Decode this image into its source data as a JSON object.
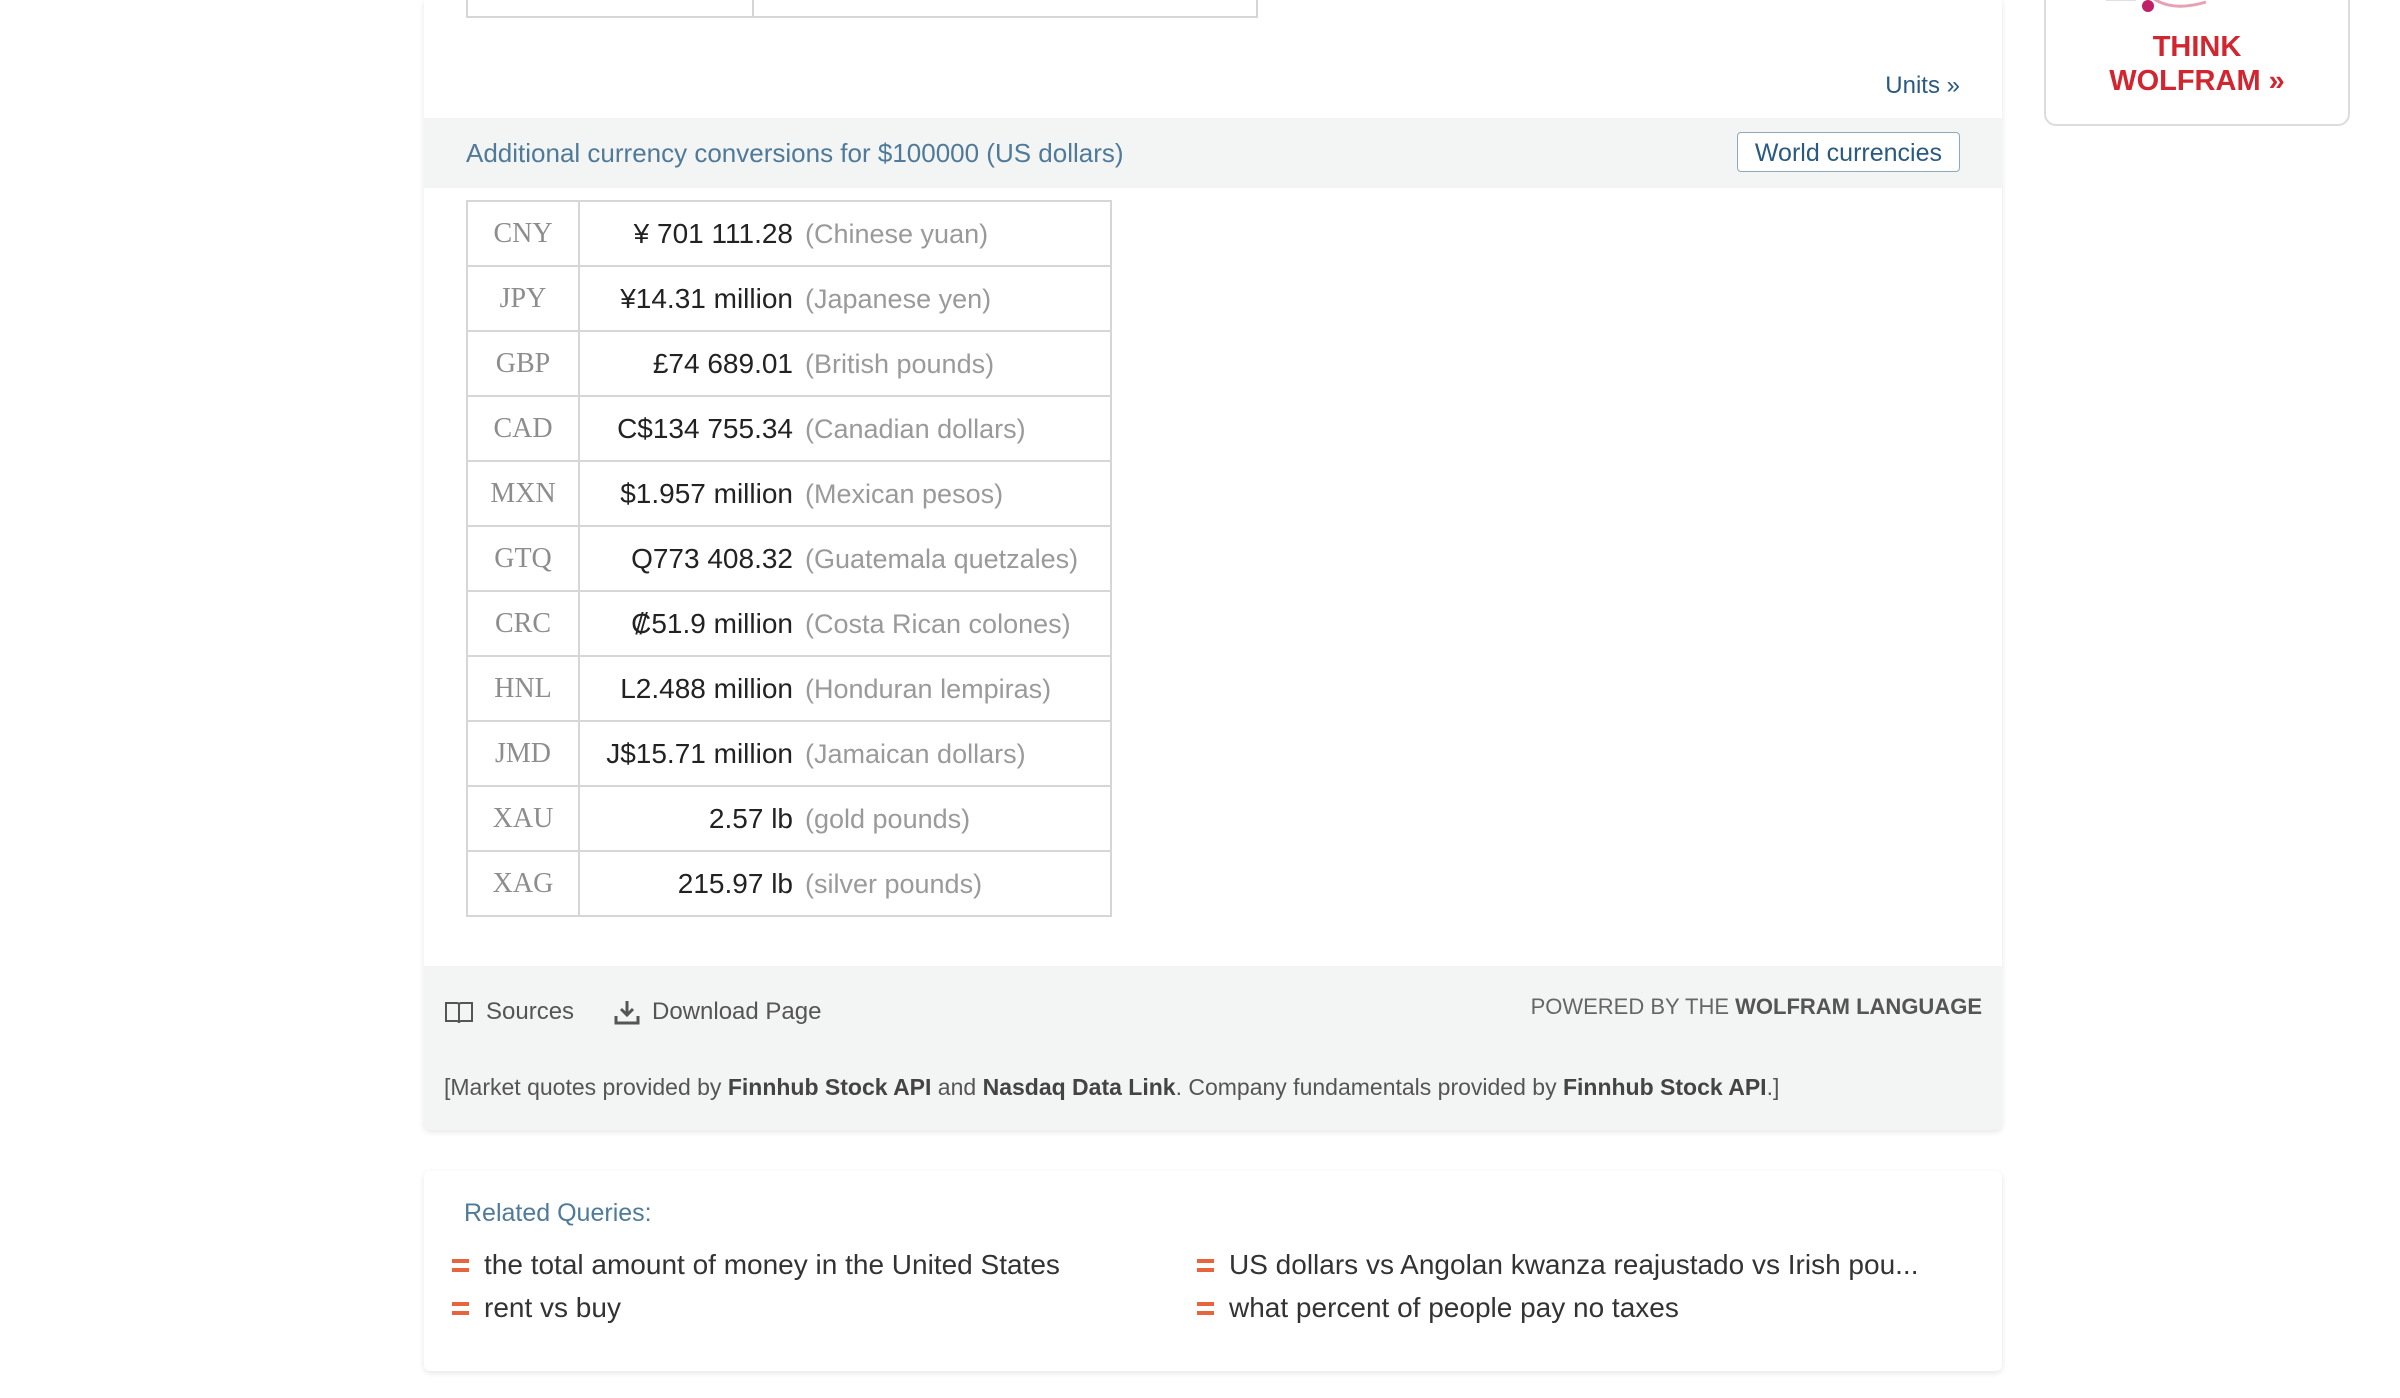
{
  "result": {
    "units_link": "Units  »",
    "conversions_title": "Additional currency conversions for $100000 (US dollars)",
    "world_currencies_button": "World currencies",
    "rows": [
      {
        "code": "CNY",
        "amount": "¥ 701 111.28",
        "desc": "(Chinese yuan)"
      },
      {
        "code": "JPY",
        "amount": "¥14.31 million",
        "desc": "(Japanese yen)"
      },
      {
        "code": "GBP",
        "amount": "£74 689.01",
        "desc": "(British pounds)"
      },
      {
        "code": "CAD",
        "amount": "C$134 755.34",
        "desc": "(Canadian dollars)"
      },
      {
        "code": "MXN",
        "amount": "$1.957 million",
        "desc": "(Mexican pesos)"
      },
      {
        "code": "GTQ",
        "amount": "Q773 408.32",
        "desc": "(Guatemala quetzales)"
      },
      {
        "code": "CRC",
        "amount": "₡51.9 million",
        "desc": "(Costa Rican colones)"
      },
      {
        "code": "HNL",
        "amount": "L2.488 million",
        "desc": "(Honduran lempiras)"
      },
      {
        "code": "JMD",
        "amount": "J$15.71 million",
        "desc": "(Jamaican dollars)"
      },
      {
        "code": "XAU",
        "amount": "2.57 lb",
        "desc": "(gold pounds)"
      },
      {
        "code": "XAG",
        "amount": "215.97 lb",
        "desc": "(silver pounds)"
      }
    ]
  },
  "footer": {
    "sources_label": "Sources",
    "download_label": "Download Page",
    "powered_prefix": "POWERED BY THE ",
    "powered_bold": "WOLFRAM LANGUAGE",
    "attribution": {
      "p1": "[Market quotes provided by ",
      "b1": "Finnhub Stock API",
      "p2": " and ",
      "b2": "Nasdaq Data Link",
      "p3": ". Company fundamentals provided by ",
      "b3": "Finnhub Stock API",
      "p4": ".]"
    }
  },
  "related": {
    "title": "Related Queries:",
    "queries": [
      "the total amount of money in the United States",
      "US dollars vs Angolan kwanza reajustado vs Irish pou...",
      "rent vs buy",
      "what percent of people pay no taxes"
    ]
  },
  "ad": {
    "line1": "THINK",
    "line2": "WOLFRAM »",
    "color": "#d1262f"
  },
  "colors": {
    "accent": "#e8643c",
    "link": "#2a5a80",
    "header_text": "#4f7a99"
  }
}
